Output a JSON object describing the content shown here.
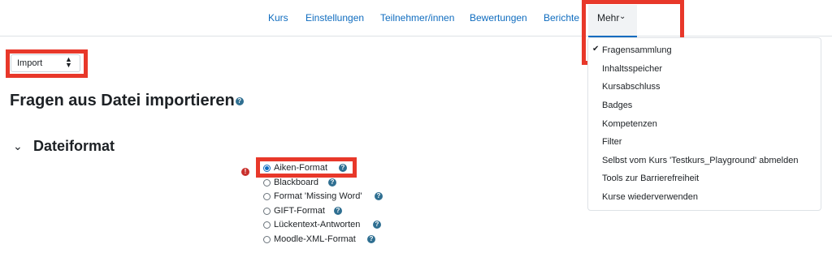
{
  "nav": {
    "items": [
      "Kurs",
      "Einstellungen",
      "Teilnehmer/innen",
      "Bewertungen",
      "Berichte"
    ],
    "more_label": "Mehr"
  },
  "more_menu": {
    "items": [
      "Fragensammlung",
      "Inhaltsspeicher",
      "Kursabschluss",
      "Badges",
      "Kompetenzen",
      "Filter",
      "Selbst vom Kurs 'Testkurs_Playground' abmelden",
      "Tools zur Barrierefreiheit",
      "Kurse wiederverwenden"
    ],
    "checked_item": "Fragensammlung"
  },
  "action_select": {
    "value": "Import"
  },
  "page": {
    "title": "Fragen aus Datei importieren"
  },
  "section": {
    "title": "Dateiformat",
    "options": [
      "Aiken-Format",
      "Blackboard",
      "Format 'Missing Word'",
      "GIFT-Format",
      "Lückentext-Antworten",
      "Moodle-XML-Format"
    ],
    "selected": "Aiken-Format"
  },
  "colors": {
    "accent": "#0f6cbf",
    "highlight": "#e8382a",
    "help": "#2f6f91",
    "error": "#c9302c"
  }
}
